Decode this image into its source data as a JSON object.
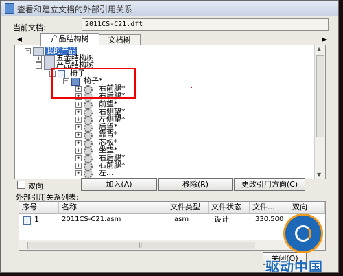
{
  "window": {
    "title": "查看和建立文档的外部引用关系"
  },
  "current_doc": {
    "label": "当前文档:",
    "value": "2011CS-C21.dft"
  },
  "tabs": [
    {
      "label": "产品结构树",
      "active": true
    },
    {
      "label": "文档树",
      "active": false
    }
  ],
  "tab_arrows": {
    "left": "◀",
    "right": "▶"
  },
  "tree": {
    "root": "我的产品",
    "hardware": "五金结构树",
    "product_tree": "产品结构树",
    "chair": "椅子",
    "chair_star": "椅子*",
    "children": [
      "右前腿*",
      "右后腿*",
      "前望*",
      "右侧望*",
      "左侧望*",
      "后望*",
      "靠背*",
      "芯板*",
      "坐垫*",
      "右后腿*",
      "右前腿*",
      "左..."
    ]
  },
  "buttons": {
    "bidirectional": "双向",
    "add": "加入(A)",
    "remove": "移除(R)",
    "change_direction": "更改引用方向(C)",
    "close": "关闭(O)"
  },
  "list": {
    "label": "外部引用关系列表:",
    "columns": [
      "序号",
      "名称",
      "文件类型",
      "文件状态",
      "文件...",
      "双向"
    ],
    "rows": [
      {
        "index": "1",
        "name": "2011CS-C21.asm",
        "type": "asm",
        "status": "设计",
        "size": "330.500",
        "bidir": ""
      }
    ]
  },
  "scroll_glyphs": {
    "up": "▲",
    "down": "▼",
    "grip": "|||"
  },
  "watermark": {
    "text": "驱动中国"
  },
  "colors": {
    "selection": "#3169c6",
    "highlight_box": "#e00000",
    "watermark": "#1d69b8"
  }
}
